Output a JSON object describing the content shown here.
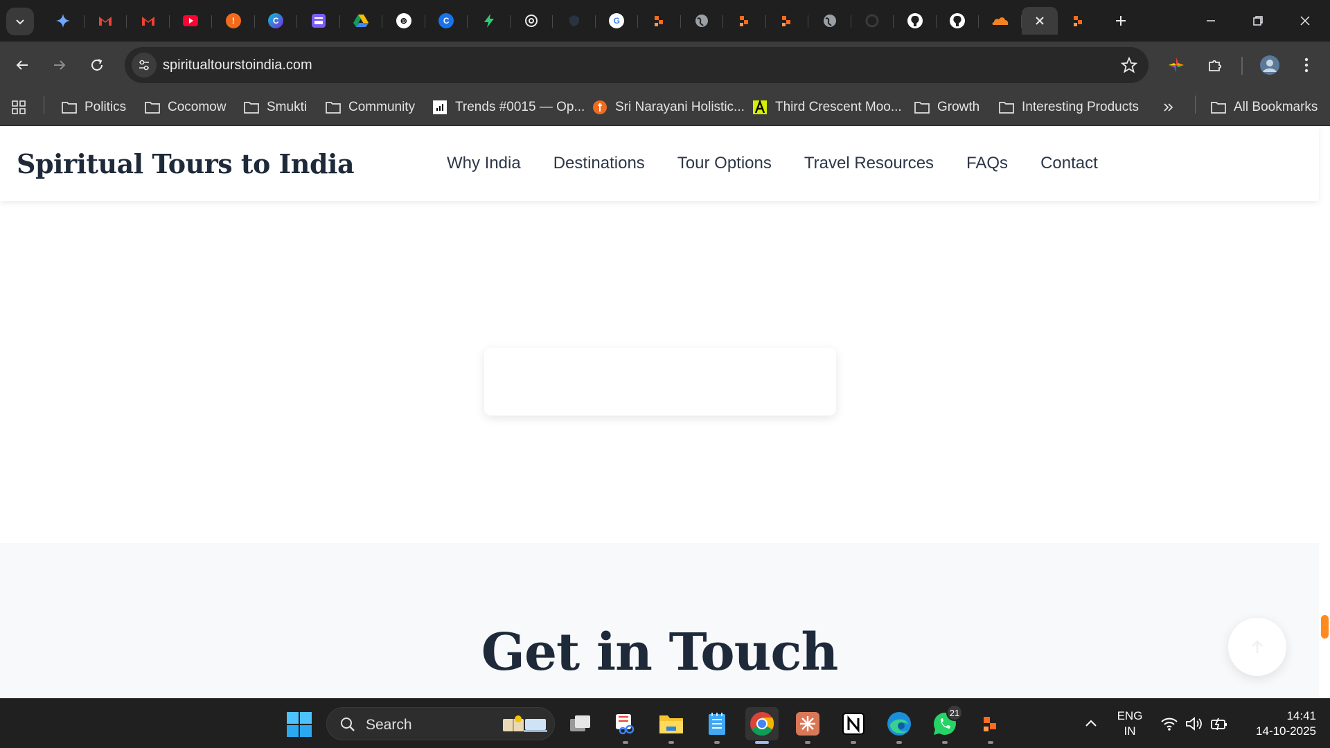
{
  "browser": {
    "url": "spiritualtourstoindia.com",
    "bookmarks": [
      {
        "label": "Politics",
        "icon": "folder-icon"
      },
      {
        "label": "Cocomow",
        "icon": "folder-icon"
      },
      {
        "label": "Smukti",
        "icon": "folder-icon"
      },
      {
        "label": "Community",
        "icon": "folder-icon"
      },
      {
        "label": "Trends #0015 — Op...",
        "icon": "trends-favicon"
      },
      {
        "label": "Sri Narayani Holistic...",
        "icon": "narayani-favicon"
      },
      {
        "label": "Third Crescent Moo...",
        "icon": "crescent-favicon"
      },
      {
        "label": "Growth",
        "icon": "folder-icon"
      },
      {
        "label": "Interesting Products",
        "icon": "folder-icon"
      }
    ],
    "all_bookmarks_label": "All Bookmarks"
  },
  "site": {
    "title": "Spiritual Tours to India",
    "nav": [
      "Why India",
      "Destinations",
      "Tour Options",
      "Travel Resources",
      "FAQs",
      "Contact"
    ],
    "contact_heading": "Get in Touch"
  },
  "taskbar": {
    "search_label": "Search",
    "whatsapp_badge": "21",
    "language_line1": "ENG",
    "language_line2": "IN",
    "time": "14:41",
    "date": "14-10-2025"
  },
  "colors": {
    "accent_scroll": "#ff8a1f",
    "heading": "#1e2a3a",
    "contact_bg": "#f7f9fb"
  }
}
